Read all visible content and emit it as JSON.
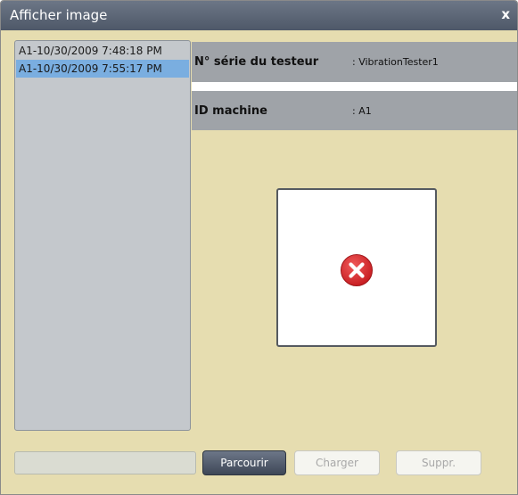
{
  "window": {
    "title": "Afficher image",
    "close_label": "x"
  },
  "records": {
    "items": [
      {
        "label": "A1-10/30/2009 7:48:18 PM",
        "selected": false
      },
      {
        "label": "A1-10/30/2009 7:55:17 PM",
        "selected": true
      }
    ]
  },
  "details": {
    "serial_label": "N° série du testeur",
    "serial_value": ": VibrationTester1",
    "machine_label": "ID machine",
    "machine_value": ": A1"
  },
  "preview": {
    "icon": "error-icon",
    "icon_color": "#d6262a"
  },
  "actions": {
    "path_value": "",
    "browse_label": "Parcourir",
    "load_label": "Charger",
    "delete_label": "Suppr."
  },
  "colors": {
    "dialog_bg": "#e6ddb0",
    "titlebar": "#5c6676",
    "selection": "#7aaee0",
    "info_row": "#9fa3a8"
  }
}
